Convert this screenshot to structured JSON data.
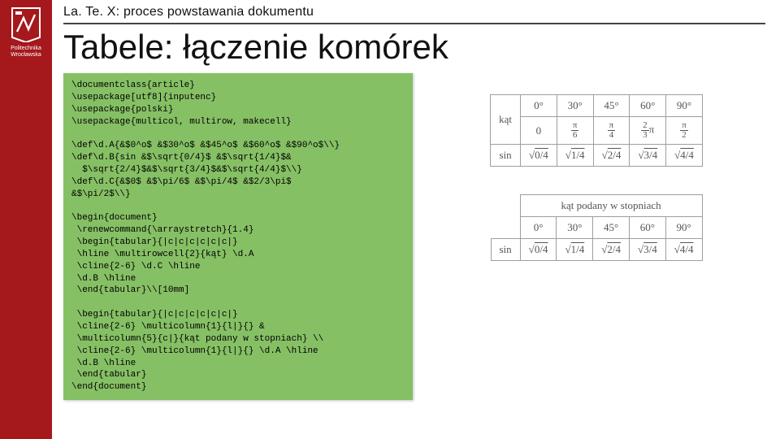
{
  "logo_caption": "Politechnika\nWrocławska",
  "breadcrumb": "La. Te. X: proces powstawania dokumentu",
  "title": "Tabele: łączenie komórek",
  "code": "\\documentclass{article}\n\\usepackage[utf8]{inputenc}\n\\usepackage{polski}\n\\usepackage{multicol, multirow, makecell}\n\n\\def\\d.A{&$0^o$ &$30^o$ &$45^o$ &$60^o$ &$90^o$\\\\}\n\\def\\d.B{sin &$\\sqrt{0/4}$ &$\\sqrt{1/4}$&\n  $\\sqrt{2/4}$&$\\sqrt{3/4}$&$\\sqrt{4/4}$\\\\}\n\\def\\d.C{&$0$ &$\\pi/6$ &$\\pi/4$ &$2/3\\pi$\n&$\\pi/2$\\\\}\n\n\\begin{document}\n \\renewcommand{\\arraystretch}{1.4}\n \\begin{tabular}{|c|c|c|c|c|c|}\n \\hline \\multirowcell{2}{kąt} \\d.A\n \\cline{2-6} \\d.C \\hline\n \\d.B \\hline\n \\end{tabular}\\\\[10mm]\n\n \\begin{tabular}{|c|c|c|c|c|c|}\n \\cline{2-6} \\multicolumn{1}{l|}{} &\n \\multicolumn{5}{c|}{kąt podany w stopniach} \\\\\n \\cline{2-6} \\multicolumn{1}{l|}{} \\d.A \\hline\n \\d.B \\hline\n \\end{tabular}\n\\end{document}",
  "table1": {
    "rowhead": "kąt",
    "rowA": [
      "0°",
      "30°",
      "45°",
      "60°",
      "90°"
    ],
    "rowC": [
      "0",
      "π/6",
      "π/4",
      "2/3π",
      "π/2"
    ],
    "sinlabel": "sin",
    "rowB": [
      "√0/4",
      "√1/4",
      "√2/4",
      "√3/4",
      "√4/4"
    ]
  },
  "table2": {
    "header_span": "kąt podany w stopniach",
    "rowA": [
      "0°",
      "30°",
      "45°",
      "60°",
      "90°"
    ],
    "sinlabel": "sin",
    "rowB": [
      "√0/4",
      "√1/4",
      "√2/4",
      "√3/4",
      "√4/4"
    ]
  },
  "chart_data": {
    "type": "table",
    "tables": [
      {
        "title": "kąt",
        "columns_deg": [
          "0°",
          "30°",
          "45°",
          "60°",
          "90°"
        ],
        "columns_rad": [
          "0",
          "π/6",
          "π/4",
          "2/3π",
          "π/2"
        ],
        "rows": [
          {
            "label": "sin",
            "values": [
              "√(0/4)",
              "√(1/4)",
              "√(2/4)",
              "√(3/4)",
              "√(4/4)"
            ]
          }
        ]
      },
      {
        "header": "kąt podany w stopniach",
        "columns_deg": [
          "0°",
          "30°",
          "45°",
          "60°",
          "90°"
        ],
        "rows": [
          {
            "label": "sin",
            "values": [
              "√(0/4)",
              "√(1/4)",
              "√(2/4)",
              "√(3/4)",
              "√(4/4)"
            ]
          }
        ]
      }
    ]
  }
}
